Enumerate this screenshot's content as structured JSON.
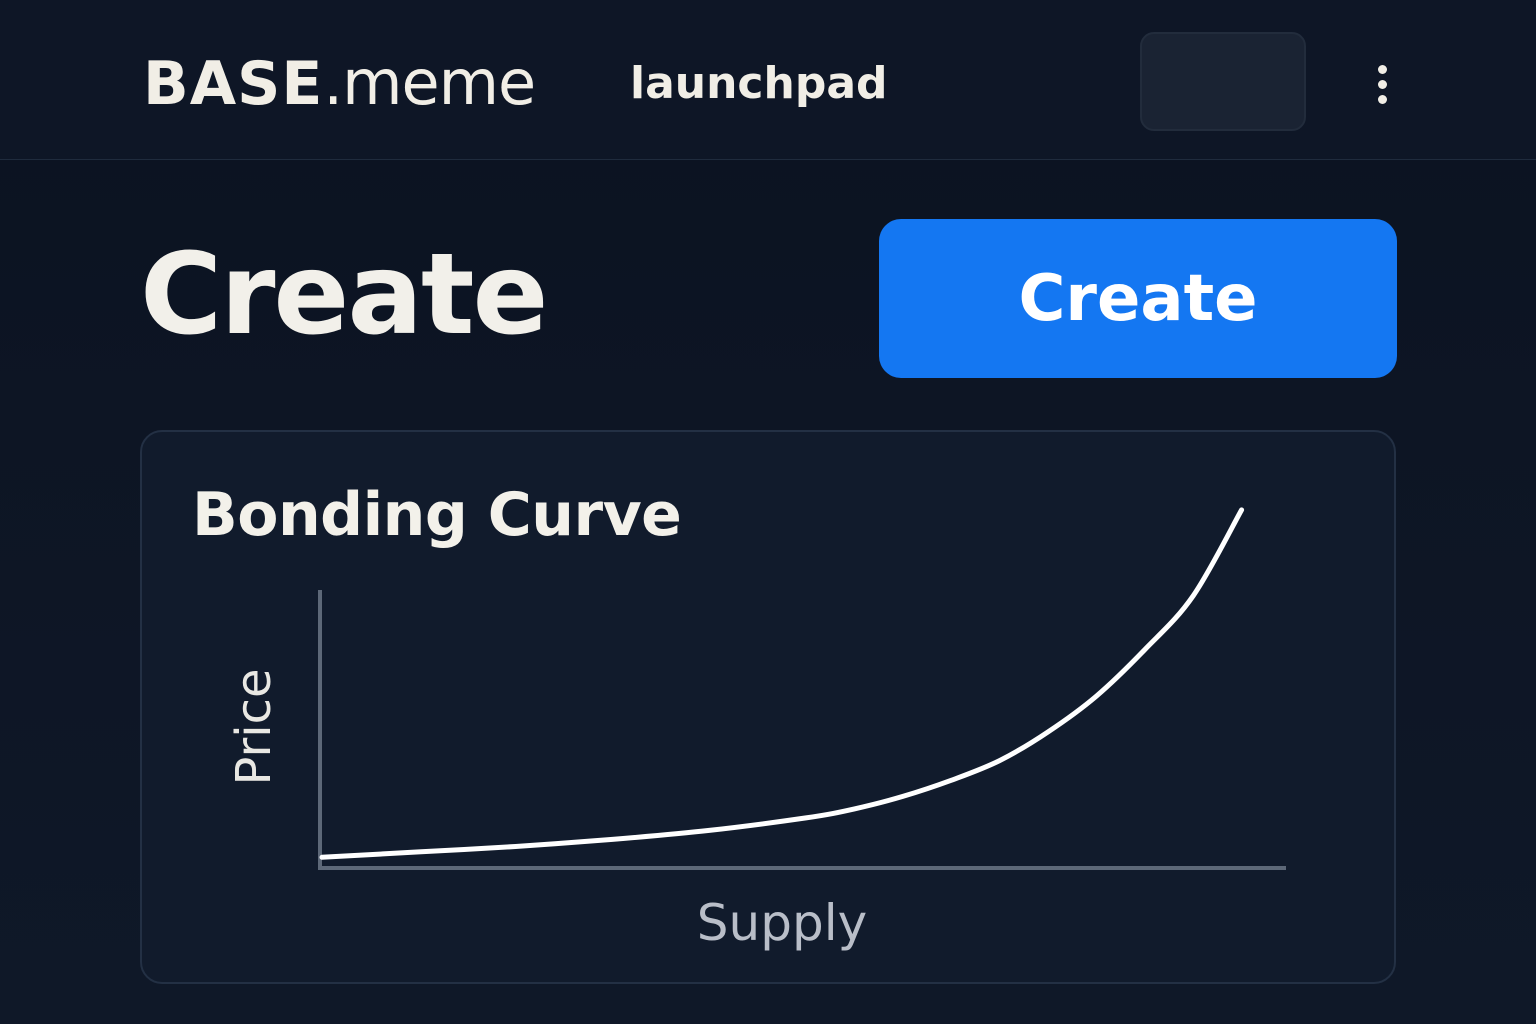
{
  "header": {
    "brand_strong": "BASE",
    "brand_light": ".meme",
    "subtitle": "launchpad"
  },
  "main": {
    "title": "Create",
    "create_button_label": "Create"
  },
  "card": {
    "title": "Bonding Curve"
  },
  "colors": {
    "background": "#0b1220",
    "accent": "#1477f2",
    "card": "#111b2c",
    "text": "#f2f0ea"
  },
  "icons": {
    "menu": "more-vertical-icon"
  },
  "chart_data": {
    "type": "line",
    "xlabel": "Supply",
    "ylabel": "Price",
    "x": [
      0,
      0.1,
      0.2,
      0.3,
      0.4,
      0.5,
      0.55,
      0.6,
      0.65,
      0.7,
      0.75,
      0.8,
      0.85,
      0.9,
      0.95
    ],
    "y": [
      0.03,
      0.045,
      0.06,
      0.08,
      0.105,
      0.14,
      0.165,
      0.2,
      0.245,
      0.3,
      0.38,
      0.48,
      0.61,
      0.76,
      1.0
    ],
    "xlim": [
      0,
      1
    ],
    "ylim": [
      0,
      1.05
    ],
    "grid": false,
    "legend": "none"
  }
}
